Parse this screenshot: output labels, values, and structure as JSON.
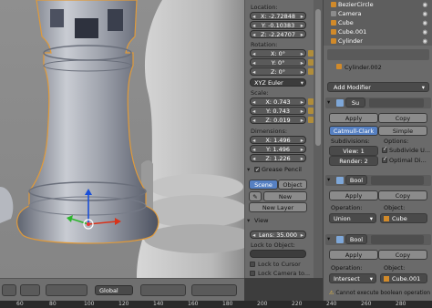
{
  "ruler_ticks": [
    "60",
    "80",
    "100",
    "120",
    "140",
    "160",
    "180",
    "200",
    "220",
    "240",
    "260",
    "280"
  ],
  "viewport_header": {
    "transform_orientation": "Global"
  },
  "npanel": {
    "location_label": "Location:",
    "location": [
      {
        "axis": "X:",
        "value": "-2.72848"
      },
      {
        "axis": "Y:",
        "value": "-0.10383"
      },
      {
        "axis": "Z:",
        "value": "-2.24707"
      }
    ],
    "rotation_label": "Rotation:",
    "rotation": [
      {
        "axis": "X:",
        "value": "0°"
      },
      {
        "axis": "Y:",
        "value": "0°"
      },
      {
        "axis": "Z:",
        "value": "0°"
      }
    ],
    "rotation_mode": "XYZ Euler",
    "scale_label": "Scale:",
    "scale": [
      {
        "axis": "X:",
        "value": "0.743"
      },
      {
        "axis": "Y:",
        "value": "0.743"
      },
      {
        "axis": "Z:",
        "value": "0.019"
      }
    ],
    "dimensions_label": "Dimensions:",
    "dimensions": [
      {
        "axis": "X:",
        "value": "1.496"
      },
      {
        "axis": "Y:",
        "value": "1.496"
      },
      {
        "axis": "Z:",
        "value": "1.226"
      }
    ],
    "grease_pencil": {
      "title": "Grease Pencil",
      "scene_tab": "Scene",
      "object_tab": "Object",
      "new_button": "New",
      "new_layer_button": "New Layer"
    },
    "view": {
      "title": "View",
      "lens_label": "Lens:",
      "lens_value": "35.000",
      "lock_to_object_label": "Lock to Object:",
      "lock_to_cursor": "Lock to Cursor",
      "lock_camera": "Lock Camera to..."
    }
  },
  "outliner": {
    "rows": [
      {
        "name": "BezierCircle",
        "color": "#d18a2a"
      },
      {
        "name": "Camera",
        "color": "#8c8c8c"
      },
      {
        "name": "Cube",
        "color": "#d18a2a"
      },
      {
        "name": "Cube.001",
        "color": "#d18a2a"
      },
      {
        "name": "Cylinder",
        "color": "#d18a2a"
      }
    ]
  },
  "properties": {
    "object_name": "Cylinder.002",
    "add_modifier": "Add Modifier",
    "subsurf": {
      "name": "Su",
      "apply": "Apply",
      "copy": "Copy",
      "catmull": "Catmull-Clark",
      "simple": "Simple",
      "subdivisions_label": "Subdivisions:",
      "options_label": "Options:",
      "view_label": "View:",
      "view_value": "1",
      "render_label": "Render:",
      "render_value": "2",
      "subdivide_uvs": "Subdivide U...",
      "optimal_display": "Optimal Di..."
    },
    "bool1": {
      "name": "Bool",
      "apply": "Apply",
      "copy": "Copy",
      "operation_label": "Operation:",
      "operation_value": "Union",
      "object_label": "Object:",
      "object_value": "Cube"
    },
    "bool2": {
      "name": "Bool",
      "apply": "Apply",
      "copy": "Copy",
      "operation_label": "Operation:",
      "operation_value": "Intersect",
      "object_label": "Object:",
      "object_value": "Cube.001",
      "warning": "Cannot execute boolean operation"
    }
  }
}
